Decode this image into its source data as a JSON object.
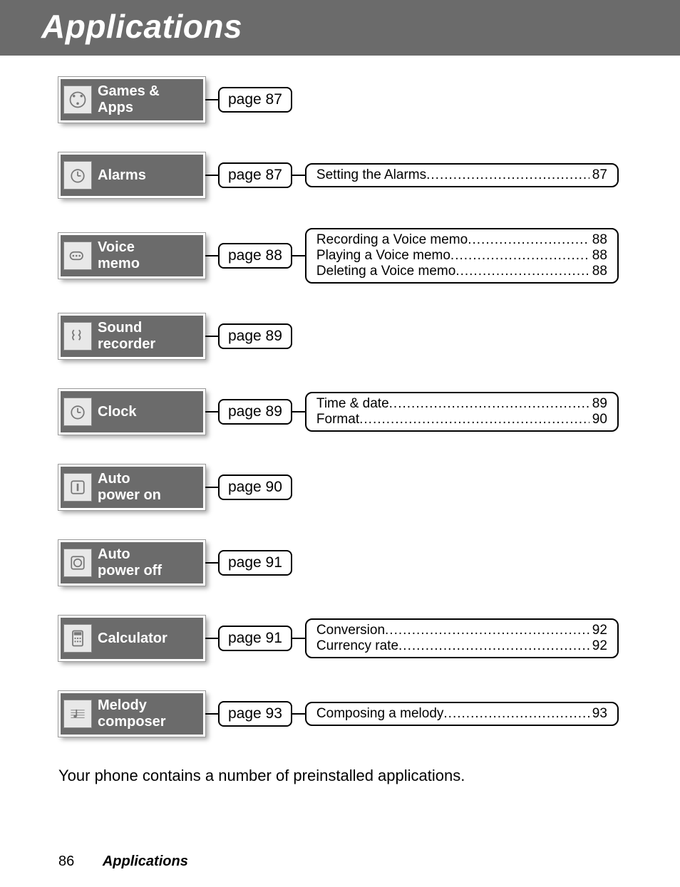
{
  "title": "Applications",
  "body_text": "Your phone contains a number of preinstalled applications.",
  "footer": {
    "page": "86",
    "chapter": "Applications"
  },
  "rows": [
    {
      "label": "Games &\nApps",
      "page": "page 87",
      "icon": "games-apps-icon",
      "details": []
    },
    {
      "label": "Alarms",
      "page": "page 87",
      "icon": "alarm-icon",
      "details": [
        {
          "text": "Setting the Alarms",
          "page": "87"
        }
      ]
    },
    {
      "label": "Voice\nmemo",
      "page": "page 88",
      "icon": "voice-memo-icon",
      "details": [
        {
          "text": "Recording a Voice memo",
          "page": "88"
        },
        {
          "text": "Playing a Voice memo",
          "page": "88"
        },
        {
          "text": "Deleting a Voice memo",
          "page": "88"
        }
      ]
    },
    {
      "label": "Sound\nrecorder",
      "page": "page 89",
      "icon": "sound-recorder-icon",
      "details": []
    },
    {
      "label": "Clock",
      "page": "page 89",
      "icon": "clock-icon",
      "details": [
        {
          "text": "Time & date",
          "page": "89"
        },
        {
          "text": "Format",
          "page": "90"
        }
      ]
    },
    {
      "label": "Auto\npower on",
      "page": "page 90",
      "icon": "power-on-icon",
      "details": []
    },
    {
      "label": "Auto\npower off",
      "page": "page 91",
      "icon": "power-off-icon",
      "details": []
    },
    {
      "label": "Calculator",
      "page": "page 91",
      "icon": "calculator-icon",
      "details": [
        {
          "text": "Conversion",
          "page": "92"
        },
        {
          "text": "Currency rate",
          "page": "92"
        }
      ]
    },
    {
      "label": "Melody\ncomposer",
      "page": "page 93",
      "icon": "melody-composer-icon",
      "details": [
        {
          "text": "Composing a melody",
          "page": "93"
        }
      ]
    }
  ]
}
